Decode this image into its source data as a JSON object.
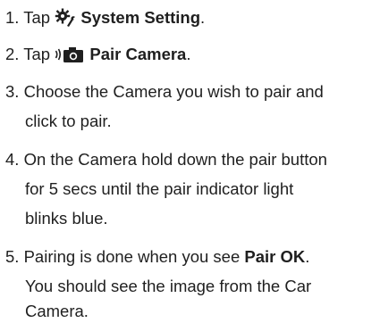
{
  "steps": [
    {
      "number": "1.",
      "prefix": "Tap",
      "icon": "gear-wrench-icon",
      "bold": "System Setting",
      "suffix": "."
    },
    {
      "number": "2.",
      "prefix": "Tap",
      "icon": "camera-signal-icon",
      "bold": "Pair Camera",
      "suffix": "."
    },
    {
      "number": "3.",
      "lines": [
        "Choose the Camera you wish to pair and",
        "click to pair."
      ]
    },
    {
      "number": "4.",
      "lines": [
        "On the Camera hold down the pair button",
        "for 5 secs until the pair indicator light",
        "blinks blue."
      ]
    },
    {
      "number": "5.",
      "prefix": "Pairing is done when you see",
      "bold": "Pair OK",
      "suffix": ".",
      "lines": [
        "You should see the image from the Car",
        "Camera."
      ]
    }
  ],
  "colors": {
    "text": "#1f1f1f"
  }
}
